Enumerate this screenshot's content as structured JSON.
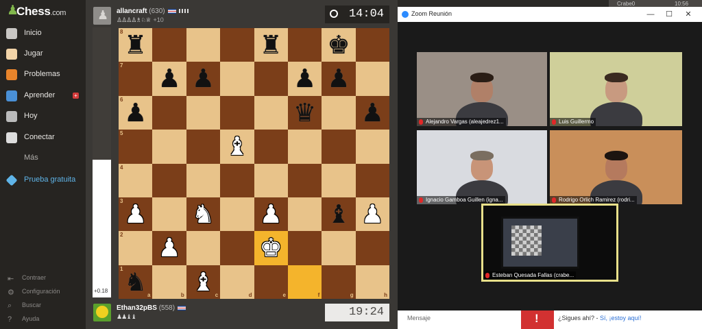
{
  "app": {
    "logo_text": "Chess",
    "logo_suffix": ".com"
  },
  "sidebar": {
    "items": [
      {
        "label": "Inicio",
        "icon": "home-icon",
        "color": "#c9c7c4"
      },
      {
        "label": "Jugar",
        "icon": "play-icon",
        "color": "#f2d4a8"
      },
      {
        "label": "Problemas",
        "icon": "puzzle-icon",
        "color": "#e8842b"
      },
      {
        "label": "Aprender",
        "icon": "learn-icon",
        "color": "#4a90d6",
        "badge": "+"
      },
      {
        "label": "Hoy",
        "icon": "today-icon",
        "color": "#bbbbbb"
      },
      {
        "label": "Conectar",
        "icon": "connect-icon",
        "color": "#dddddd"
      },
      {
        "label": "Más",
        "icon": "",
        "color": ""
      },
      {
        "label": "Prueba gratuita",
        "icon": "diamond-icon",
        "color": "#5fb4e8",
        "accent": true
      }
    ],
    "footer": [
      {
        "label": "Contraer",
        "icon": "collapse-icon"
      },
      {
        "label": "Configuración",
        "icon": "gear-icon"
      },
      {
        "label": "Buscar",
        "icon": "search-icon"
      },
      {
        "label": "Ayuda",
        "icon": "help-icon"
      }
    ]
  },
  "top_player": {
    "name": "allancraft",
    "rating": "(630)",
    "captured": "♙♙♙♙♗♘♕",
    "points": "+10",
    "clock": "14:04"
  },
  "bottom_player": {
    "name": "Ethan32pBS",
    "rating": "(558)",
    "captured": "♟♟♝♝",
    "clock": "19:24"
  },
  "eval": {
    "value": "+0.18",
    "white_fraction": 0.51
  },
  "board": {
    "ranks": [
      "8",
      "7",
      "6",
      "5",
      "4",
      "3",
      "2",
      "1"
    ],
    "files": [
      "a",
      "b",
      "c",
      "d",
      "e",
      "f",
      "g",
      "h"
    ],
    "light": "#e8c38a",
    "dark": "#7b3e19",
    "highlight": "#f4b42c",
    "highlighted_squares": [
      "e2",
      "f1"
    ],
    "pieces": [
      {
        "sq": "a8",
        "g": "♜",
        "c": "b"
      },
      {
        "sq": "e8",
        "g": "♜",
        "c": "b"
      },
      {
        "sq": "g8",
        "g": "♚",
        "c": "b"
      },
      {
        "sq": "b7",
        "g": "♟",
        "c": "b"
      },
      {
        "sq": "c7",
        "g": "♟",
        "c": "b"
      },
      {
        "sq": "f7",
        "g": "♟",
        "c": "b"
      },
      {
        "sq": "g7",
        "g": "♟",
        "c": "b"
      },
      {
        "sq": "a6",
        "g": "♟",
        "c": "b"
      },
      {
        "sq": "f6",
        "g": "♛",
        "c": "b"
      },
      {
        "sq": "h6",
        "g": "♟",
        "c": "b"
      },
      {
        "sq": "d5",
        "g": "♝",
        "c": "w"
      },
      {
        "sq": "a3",
        "g": "♟",
        "c": "w"
      },
      {
        "sq": "c3",
        "g": "♞",
        "c": "w"
      },
      {
        "sq": "e3",
        "g": "♟",
        "c": "w"
      },
      {
        "sq": "g3",
        "g": "♝",
        "c": "b"
      },
      {
        "sq": "h3",
        "g": "♟",
        "c": "w"
      },
      {
        "sq": "b2",
        "g": "♟",
        "c": "w"
      },
      {
        "sq": "e2",
        "g": "♚",
        "c": "w"
      },
      {
        "sq": "a1",
        "g": "♞",
        "c": "b"
      },
      {
        "sq": "c1",
        "g": "♝",
        "c": "w"
      }
    ]
  },
  "topstrip": {
    "left": "Crabe0",
    "right": "10:56"
  },
  "zoom": {
    "title": "Zoom Reunión",
    "controls": {
      "minimize": "—",
      "maximize": "☐",
      "close": "✕"
    },
    "participants": [
      {
        "name": "Alejandro Vargas (aleajedrez1...",
        "bg": "#9a8f86",
        "skin": "#b08068",
        "hair": "#2a1d15"
      },
      {
        "name": "Luis Guillermo",
        "bg": "#cfcf9a",
        "skin": "#c89a80",
        "hair": "#3a2a20"
      },
      {
        "name": "Ignacio Gamboa Guillen (igna...",
        "bg": "#d9dbe0",
        "skin": "#c89478",
        "hair": "#7a6e60"
      },
      {
        "name": "Rodrigo Orlich Ramirez (rodri...",
        "bg": "#c98f5a",
        "skin": "#b57a5e",
        "hair": "#1c1410"
      },
      {
        "name": "Esteban Quesada Fallas (crabe...",
        "bg": "#0c0c0c",
        "skin": "",
        "hair": "",
        "active": true
      }
    ]
  },
  "chatbar": {
    "message": "Mensaje",
    "question": "¿Sigues ahí? - ",
    "answer": "Sí, ¡estoy aquí!",
    "warn_icon": "!"
  }
}
